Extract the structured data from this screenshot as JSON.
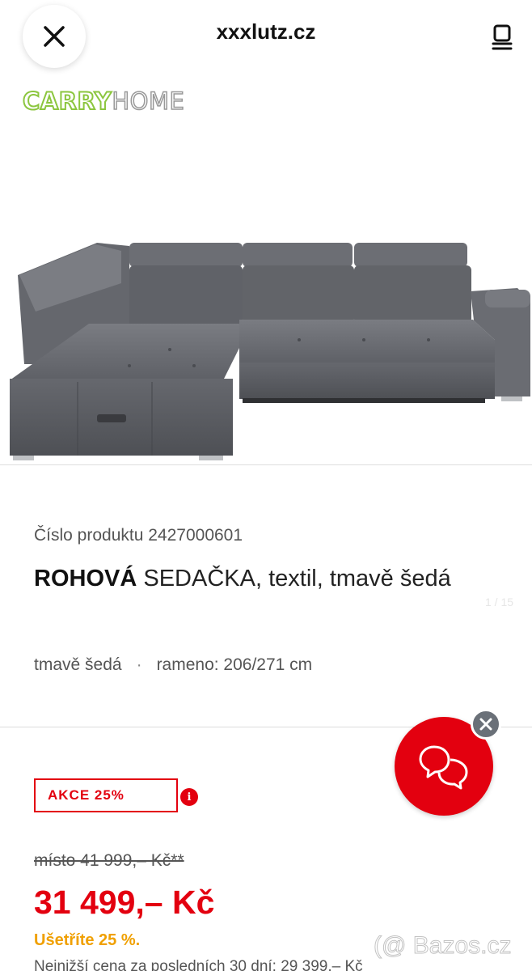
{
  "header": {
    "domain": "xxxlutz.cz",
    "close_icon": "close-icon",
    "menu_icon": "menu-icon"
  },
  "brand": {
    "carry": "CARRY",
    "home": "HOME",
    "colors": {
      "carry": "#8cc63f",
      "home": "#999999"
    }
  },
  "product": {
    "number_label": "Číslo produktu",
    "number": "2427000601",
    "title_bold": "ROHOVÁ",
    "title_rest": "SEDAČKA, textil, tmavě šedá",
    "ghost_pager": "1 / 15",
    "attributes": [
      "tmavě šedá",
      "rameno: 206/271 cm"
    ],
    "attribute_separator": "·"
  },
  "pricing": {
    "badge": "AKCE 25%",
    "badge_info": "i",
    "old_price": "místo 41 999,– Kč**",
    "new_price": "31 499,– Kč",
    "savings": "Ušetříte 25 %.",
    "lowest_price": "Nejnižší cena za posledních 30 dní: 29 399,– Kč"
  },
  "chat": {
    "icon": "chat-bubbles-icon",
    "close_icon": "close-icon"
  },
  "watermark": "(@ Bazos.cz",
  "colors": {
    "accent": "#e3000f",
    "savings": "#f0a000",
    "text": "#222222",
    "muted": "#555555"
  }
}
